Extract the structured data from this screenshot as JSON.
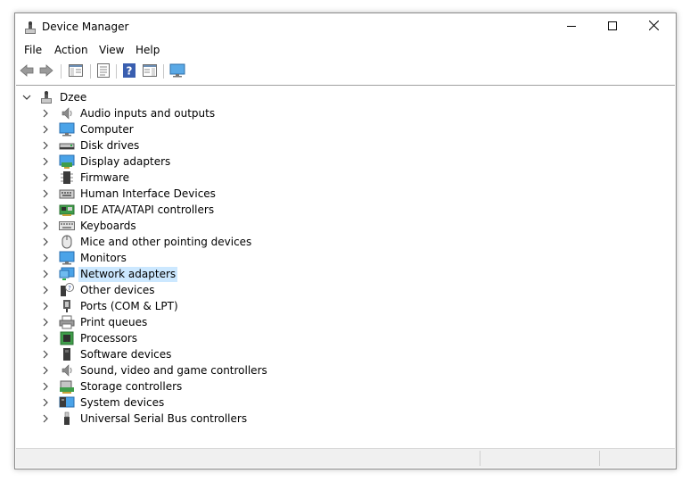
{
  "window": {
    "title": "Device Manager"
  },
  "title_buttons": {
    "minimize_icon": "minimize-icon",
    "maximize_icon": "maximize-icon",
    "close_icon": "close-icon"
  },
  "menu": [
    "File",
    "Action",
    "View",
    "Help"
  ],
  "toolbar": [
    "back",
    "forward",
    "show-hide-console-tree",
    "properties",
    "help",
    "action-pane",
    "scan-hardware"
  ],
  "tree": {
    "root": "Dzee",
    "selected_index": 10,
    "items": [
      {
        "label": "Audio inputs and outputs",
        "icon": "speaker-icon"
      },
      {
        "label": "Computer",
        "icon": "computer-icon"
      },
      {
        "label": "Disk drives",
        "icon": "disk-drive-icon"
      },
      {
        "label": "Display adapters",
        "icon": "display-adapter-icon"
      },
      {
        "label": "Firmware",
        "icon": "firmware-icon"
      },
      {
        "label": "Human Interface Devices",
        "icon": "hid-icon"
      },
      {
        "label": "IDE ATA/ATAPI controllers",
        "icon": "ide-controller-icon"
      },
      {
        "label": "Keyboards",
        "icon": "keyboard-icon"
      },
      {
        "label": "Mice and other pointing devices",
        "icon": "mouse-icon"
      },
      {
        "label": "Monitors",
        "icon": "monitor-icon"
      },
      {
        "label": "Network adapters",
        "icon": "network-adapter-icon"
      },
      {
        "label": "Other devices",
        "icon": "unknown-device-icon"
      },
      {
        "label": "Ports (COM & LPT)",
        "icon": "port-icon"
      },
      {
        "label": "Print queues",
        "icon": "printer-icon"
      },
      {
        "label": "Processors",
        "icon": "processor-icon"
      },
      {
        "label": "Software devices",
        "icon": "software-device-icon"
      },
      {
        "label": "Sound, video and game controllers",
        "icon": "sound-icon"
      },
      {
        "label": "Storage controllers",
        "icon": "storage-controller-icon"
      },
      {
        "label": "System devices",
        "icon": "system-device-icon"
      },
      {
        "label": "Universal Serial Bus controllers",
        "icon": "usb-icon"
      }
    ]
  },
  "colors": {
    "selection": "#cce8ff",
    "accent": "#0078d7"
  }
}
